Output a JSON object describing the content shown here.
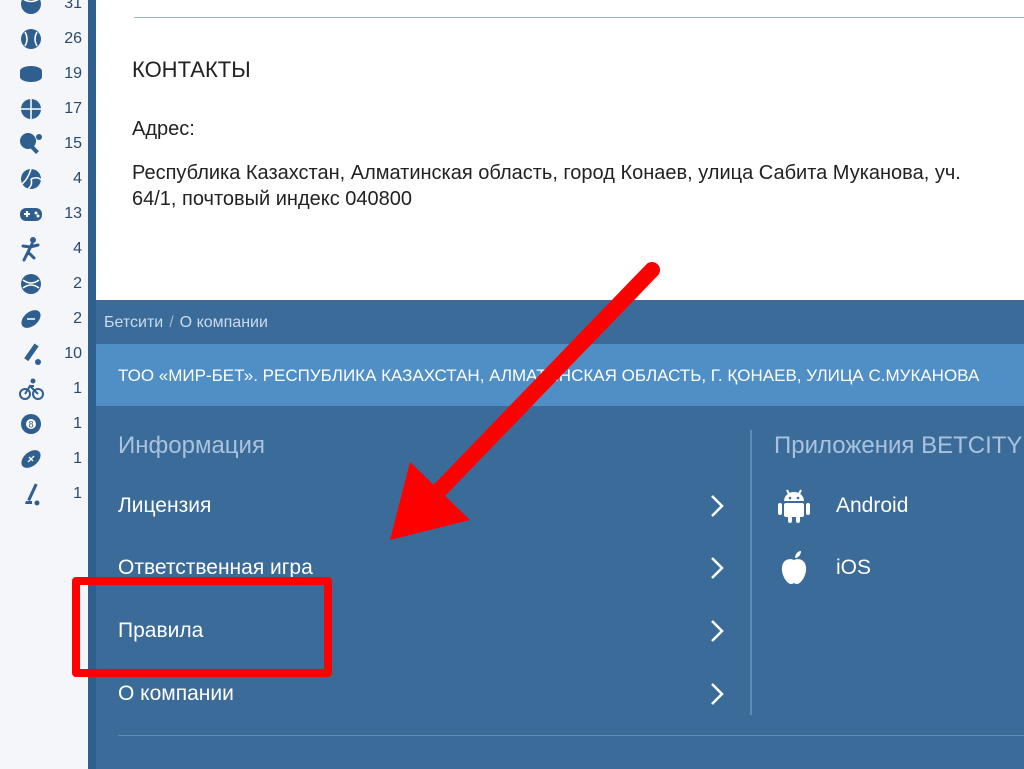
{
  "sidebar": {
    "items": [
      {
        "icon": "tennis-icon",
        "count": "31"
      },
      {
        "icon": "baseball-icon",
        "count": "26"
      },
      {
        "icon": "hockey-puck-icon",
        "count": "19"
      },
      {
        "icon": "basketball-icon",
        "count": "17"
      },
      {
        "icon": "table-tennis-icon",
        "count": "15"
      },
      {
        "icon": "volleyball-icon",
        "count": "4"
      },
      {
        "icon": "gamepad-icon",
        "count": "13"
      },
      {
        "icon": "handball-icon",
        "count": "4"
      },
      {
        "icon": "water-polo-icon",
        "count": "2"
      },
      {
        "icon": "rugby-icon",
        "count": "2"
      },
      {
        "icon": "cricket-icon",
        "count": "10"
      },
      {
        "icon": "cycling-icon",
        "count": "1"
      },
      {
        "icon": "billiards-icon",
        "count": "1"
      },
      {
        "icon": "american-football-icon",
        "count": "1"
      },
      {
        "icon": "golf-icon",
        "count": "1"
      }
    ]
  },
  "contacts": {
    "title": "КОНТАКТЫ",
    "address_label": "Адрес:",
    "address": "Республика Казахстан, Алматинская область, город Конаев, улица Сабита Муканова, уч. 64/1, почтовый индекс 040800"
  },
  "footer": {
    "breadcrumb": {
      "home": "Бетсити",
      "separator": "/",
      "current": "О компании"
    },
    "company_text": "ТОО «МИР-БЕТ». РЕСПУБЛИКА КАЗАХСТАН, АЛМАТИНСКАЯ ОБЛАСТЬ, Г. ҚОНАЕВ, УЛИЦА С.МУКАНОВА",
    "info_title": "Информация",
    "info_links": [
      "Лицензия",
      "Ответственная игра",
      "Правила",
      "О компании"
    ],
    "apps_title": "Приложения BETCITY",
    "apps": [
      {
        "icon": "android-icon",
        "label": "Android"
      },
      {
        "icon": "apple-icon",
        "label": "iOS"
      }
    ]
  },
  "colors": {
    "footer_bg": "#3b6b98",
    "company_bar": "#4f8fc6",
    "annotation_red": "#ff0000"
  }
}
